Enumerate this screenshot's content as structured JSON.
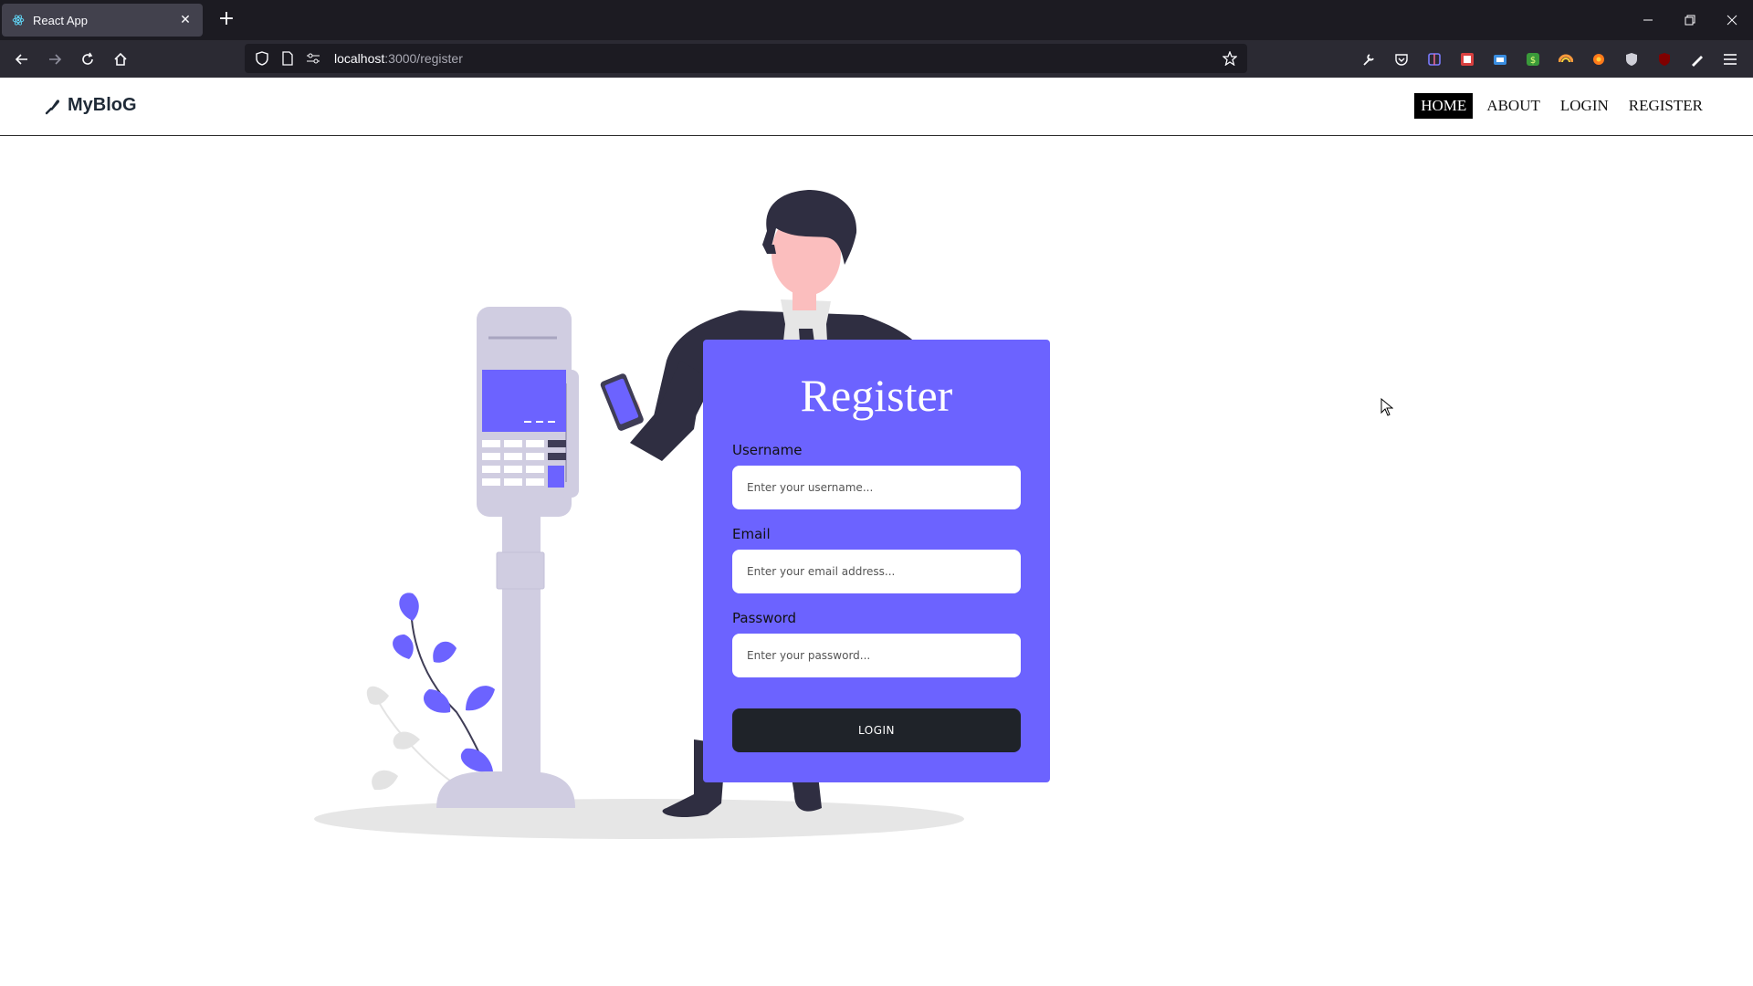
{
  "browser": {
    "tab_title": "React App",
    "url_host": "localhost",
    "url_path": ":3000/register",
    "icons": [
      "react-favicon",
      "close-icon",
      "plus-icon",
      "minimize-icon",
      "restore-icon",
      "close-window-icon",
      "back-icon",
      "forward-icon",
      "reload-icon",
      "home-icon",
      "shield-icon",
      "page-icon",
      "permissions-icon",
      "bookmark-star-icon"
    ]
  },
  "site": {
    "brand": "MyBloG",
    "nav": [
      {
        "label": "HOME",
        "active": true
      },
      {
        "label": "ABOUT",
        "active": false
      },
      {
        "label": "LOGIN",
        "active": false
      },
      {
        "label": "REGISTER",
        "active": false
      }
    ]
  },
  "form": {
    "title": "Register",
    "username_label": "Username",
    "username_placeholder": "Enter your username...",
    "email_label": "Email",
    "email_placeholder": "Enter your email address...",
    "password_label": "Password",
    "password_placeholder": "Enter your password...",
    "submit_label": "LOGIN"
  },
  "colors": {
    "accent": "#6c63ff",
    "button": "#1f2329",
    "chrome_dark": "#1c1b22",
    "chrome_toolbar": "#2b2a33"
  }
}
